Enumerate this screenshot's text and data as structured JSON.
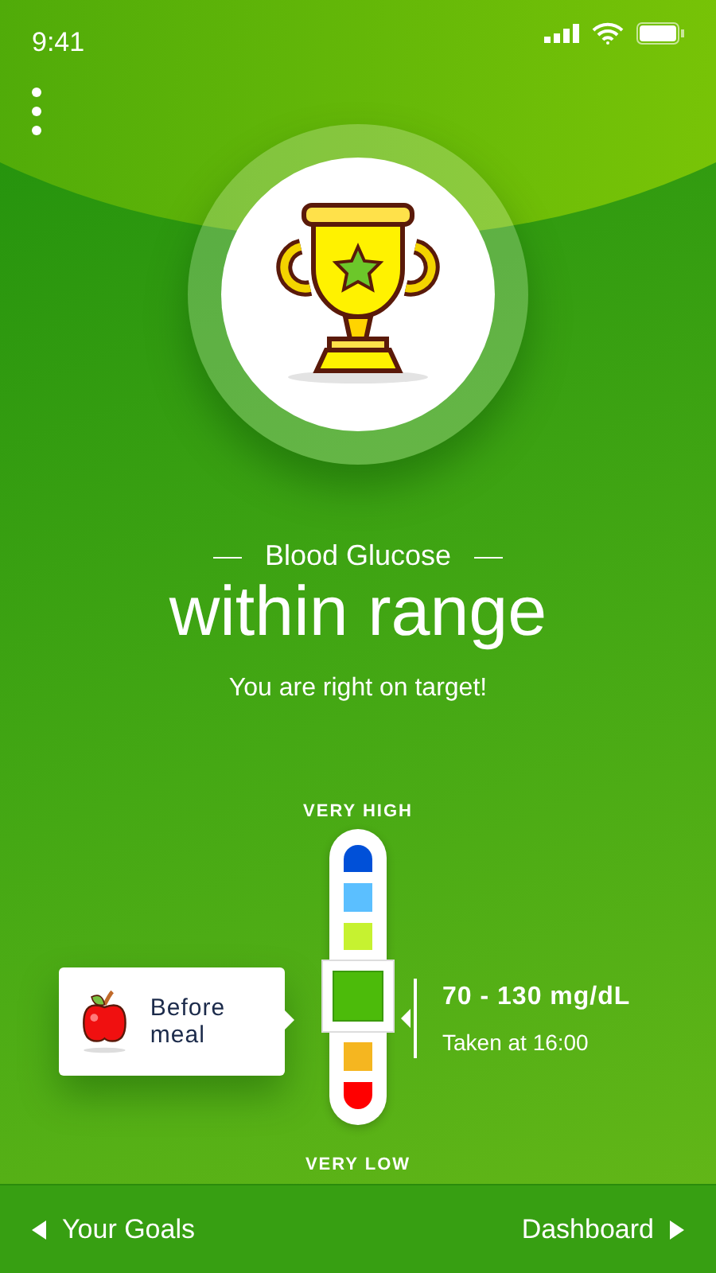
{
  "status_bar": {
    "time": "9:41"
  },
  "result": {
    "label": "Blood Glucose",
    "status": "within range",
    "message": "You are right on target!"
  },
  "scale": {
    "top_label": "VERY HIGH",
    "bottom_label": "VERY LOW",
    "segments": [
      {
        "color": "#0050d8",
        "selected": false
      },
      {
        "color": "#5bbfff",
        "selected": false
      },
      {
        "color": "#c6f230",
        "selected": false
      },
      {
        "color": "#4cbb0a",
        "selected": true
      },
      {
        "color": "#f5b620",
        "selected": false
      },
      {
        "color": "#ff0000",
        "selected": false
      }
    ]
  },
  "meal_card": {
    "text": "Before meal"
  },
  "reading": {
    "range": "70 - 130 mg/dL",
    "taken": "Taken at 16:00"
  },
  "footer": {
    "back": "Your Goals",
    "next": "Dashboard"
  }
}
